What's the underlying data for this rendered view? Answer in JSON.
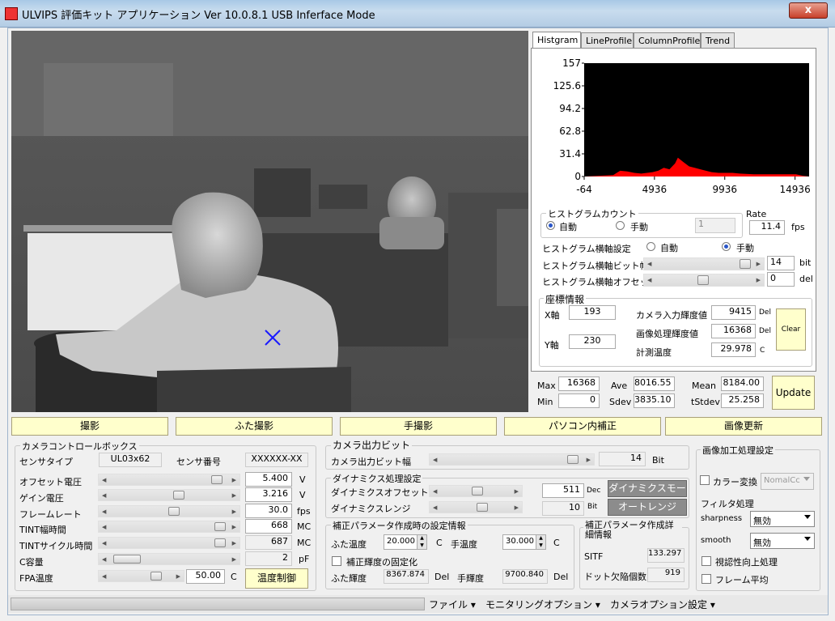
{
  "window": {
    "title": "ULVIPS 評価キット アプリケーション Ver 10.0.8.1  USB Inferface Mode",
    "close": "x"
  },
  "tabs": [
    "Histgram",
    "LineProfile",
    "ColumnProfile",
    "Trend"
  ],
  "histogram": {
    "yticks": [
      "157",
      "125.6",
      "94.2",
      "62.8",
      "31.4",
      "0"
    ],
    "xticks": [
      "-64",
      "4936",
      "9936",
      "14936"
    ],
    "bar_color": "#ff0000"
  },
  "chart_data": {
    "type": "area",
    "ylim": [
      0,
      157
    ],
    "xlim": [
      -64,
      15936
    ],
    "x": [
      -64,
      1000,
      2000,
      2500,
      3000,
      3500,
      4000,
      4400,
      4800,
      5200,
      5600,
      6000,
      6200,
      6400,
      6600,
      7000,
      7400,
      7800,
      8200,
      8600,
      9000,
      9500,
      10000,
      10500,
      11000,
      12000,
      13000,
      14000,
      15000,
      15500,
      15936
    ],
    "y": [
      0,
      1,
      2,
      8,
      7,
      5,
      4,
      5,
      6,
      8,
      12,
      10,
      14,
      18,
      26,
      20,
      14,
      12,
      10,
      8,
      6,
      5,
      5,
      5,
      4,
      3,
      3,
      3,
      3,
      1,
      0
    ]
  },
  "hist_count": {
    "title": "ヒストグラムカウント",
    "auto": "自動",
    "manual": "手動",
    "value": "1"
  },
  "rate": {
    "label": "Rate",
    "value": "11.4",
    "unit": "fps"
  },
  "hist_axis": {
    "label": "ヒストグラム横軸設定",
    "auto": "自動",
    "manual": "手動",
    "bitwidth_label": "ヒストグラム横軸ビット幅",
    "bitwidth": "14",
    "bitwidth_unit": "bit",
    "offset_label": "ヒストグラム横軸オフセット",
    "offset": "0",
    "offset_unit": "del"
  },
  "coord": {
    "title": "座標情報",
    "x_label": "X軸",
    "x": "193",
    "y_label": "Y軸",
    "y": "230",
    "cam_label": "カメラ入力輝度値",
    "cam": "9415",
    "cam_unit": "Del",
    "img_label": "画像処理輝度値",
    "img": "16368",
    "img_unit": "Del",
    "temp_label": "計測温度",
    "temp": "29.978",
    "temp_unit": "C",
    "clear": "Clear"
  },
  "stats": {
    "max_label": "Max",
    "max": "16368",
    "min_label": "Min",
    "min": "0",
    "ave_label": "Ave",
    "ave": "8016.55",
    "sdev_label": "Sdev",
    "sdev": "3835.10",
    "mean_label": "Mean",
    "mean": "8184.00",
    "tsdev_label": "tStdev",
    "tsdev": "25.258",
    "update": "Update"
  },
  "buttons": [
    "撮影",
    "ふた撮影",
    "手撮影",
    "パソコン内補正",
    "画像更新"
  ],
  "camctrl": {
    "title": "カメラコントロールボックス",
    "sensor_type_label": "センサタイプ",
    "sensor_type": "UL03x62",
    "sensor_no_label": "センサ番号",
    "sensor_no": "XXXXXX-XX",
    "rows": [
      {
        "label": "オフセット電圧",
        "value": "5.400",
        "unit": "V"
      },
      {
        "label": "ゲイン電圧",
        "value": "3.216",
        "unit": "V"
      },
      {
        "label": "フレームレート",
        "value": "30.0",
        "unit": "fps"
      },
      {
        "label": "TINT幅時間",
        "value": "668",
        "unit": "MC"
      },
      {
        "label": "TINTサイクル時間",
        "value": "687",
        "unit": "MC"
      },
      {
        "label": "C容量",
        "value": "2",
        "unit": "pF"
      }
    ],
    "fpa_label": "FPA温度",
    "fpa": "50.00",
    "fpa_unit": "C",
    "temp_ctrl": "温度制御"
  },
  "bit": {
    "title": "カメラ出力ビット",
    "label": "カメラ出力ビット幅",
    "value": "14",
    "unit": "Bit"
  },
  "dyn": {
    "title": "ダイナミクス処理設定",
    "offset_label": "ダイナミクスオフセット",
    "offset": "511",
    "offset_unit": "Dec",
    "range_label": "ダイナミクスレンジ",
    "range": "10",
    "range_unit": "Bit",
    "mode_btn": "ダイナミクスモード",
    "auto_btn": "オートレンジ"
  },
  "corr": {
    "title": "補正パラメータ作成時の設定情報",
    "lid_temp_label": "ふた温度",
    "lid_temp": "20.000",
    "lid_temp_unit": "C",
    "hand_temp_label": "手温度",
    "hand_temp": "30.000",
    "hand_temp_unit": "C",
    "fix_label": "補正輝度の固定化",
    "lid_lum_label": "ふた輝度",
    "lid_lum": "8367.874",
    "lid_lum_unit": "Del",
    "hand_lum_label": "手輝度",
    "hand_lum": "9700.840",
    "hand_lum_unit": "Del"
  },
  "detail": {
    "title": "補正パラメータ作成詳細情報",
    "sitf_label": "SITF",
    "sitf": "133.297",
    "defect_label": "ドット欠陥個数",
    "defect": "919"
  },
  "imgproc": {
    "title": "画像加工処理設定",
    "color_label": "カラー変換",
    "color_value": "NomalCc",
    "filter_title": "フィルタ処理",
    "sharp_label": "sharpness",
    "sharp_value": "無効",
    "smooth_label": "smooth",
    "smooth_value": "無効",
    "vis_label": "視認性向上処理",
    "frame_label": "フレーム平均"
  },
  "menubar": [
    "ファイル ▾",
    "モニタリングオプション ▾",
    "カメラオプション設定 ▾"
  ]
}
